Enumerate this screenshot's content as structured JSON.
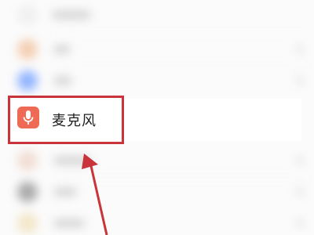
{
  "settings": {
    "microphone": {
      "label": "麦克风",
      "icon": "microphone-icon",
      "icon_color": "#ef6a55"
    }
  },
  "annotation": {
    "box_color": "#c8343a",
    "arrow_color": "#c8343a"
  }
}
